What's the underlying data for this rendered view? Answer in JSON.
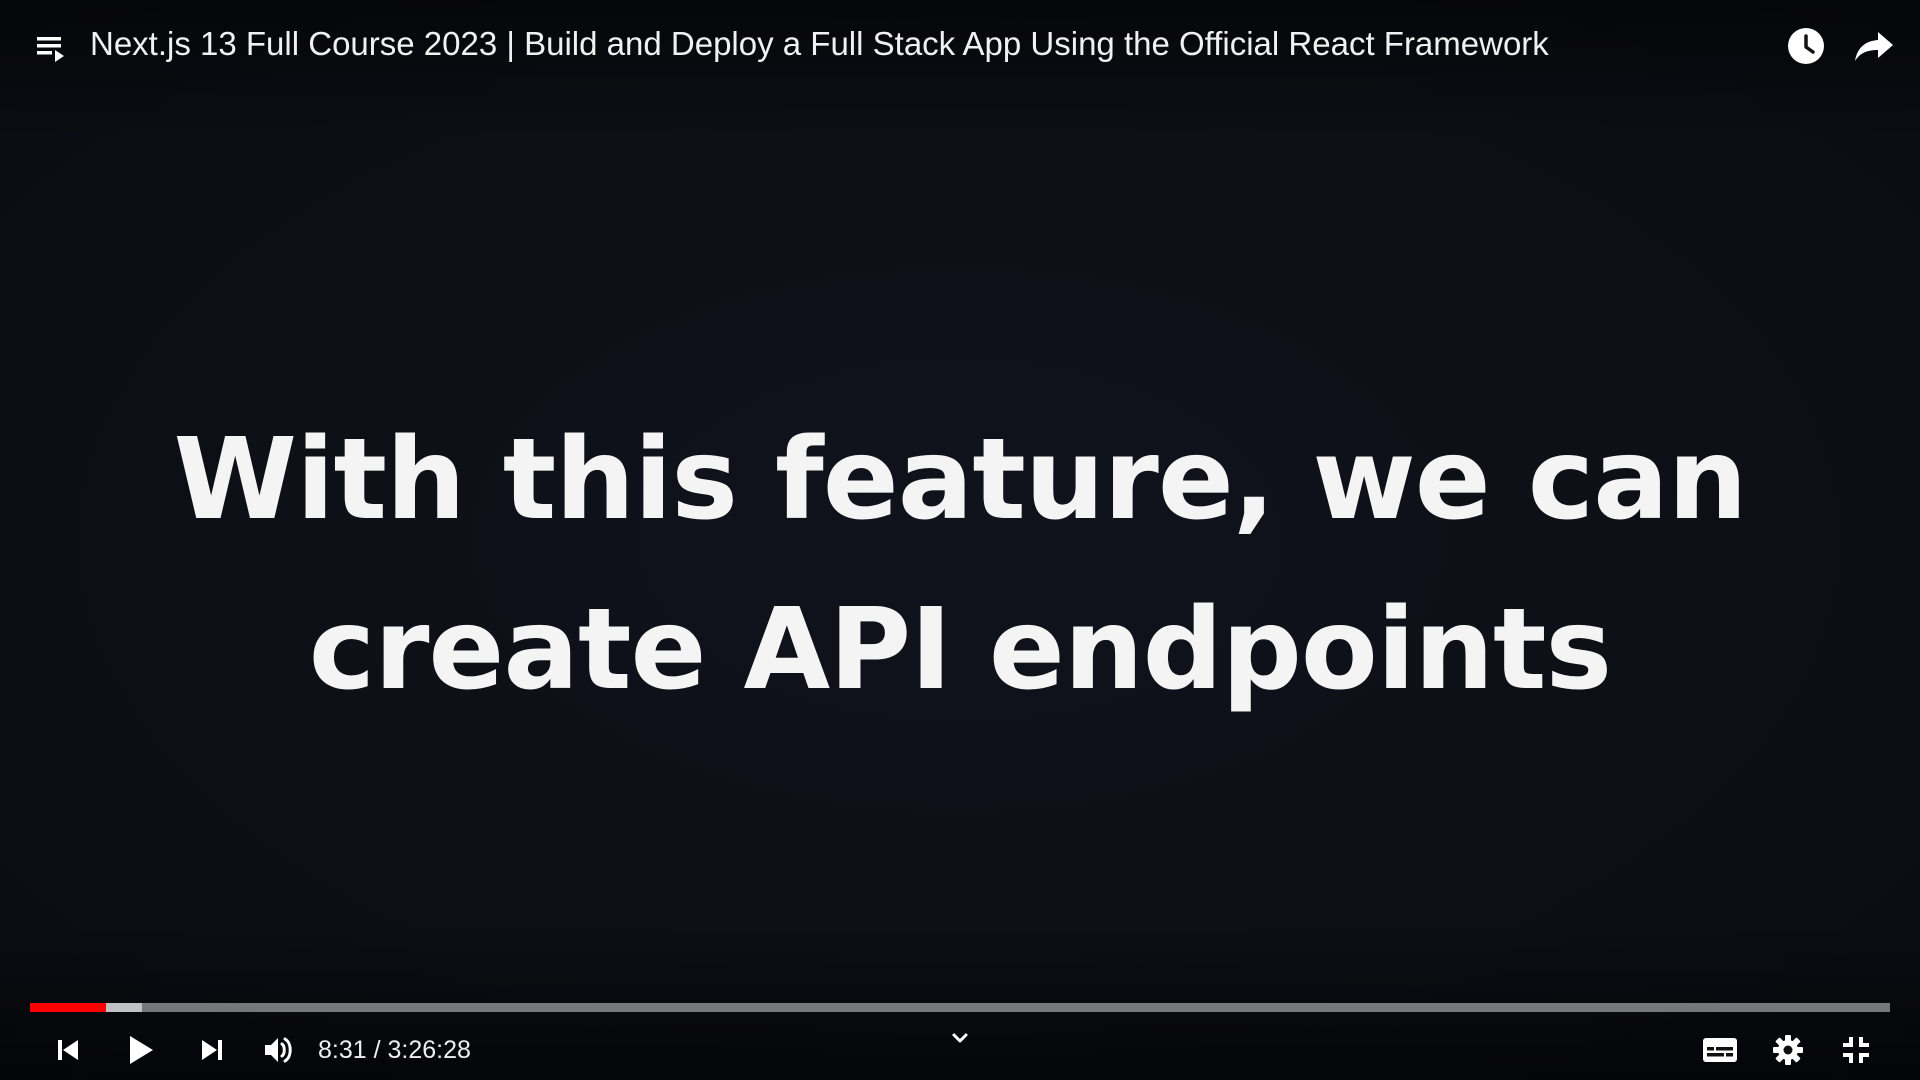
{
  "player": {
    "title": "Next.js 13 Full Course 2023 | Build and Deploy a Full Stack App Using the Official React Framework",
    "caption_lines": [
      "With this feature, we can",
      "create API endpoints"
    ],
    "time": {
      "current": "8:31",
      "separator": " / ",
      "duration": "3:26:28"
    },
    "progress": {
      "played_fraction": 0.041,
      "loaded_fraction": 0.06
    },
    "colors": {
      "progress_played": "#ff0000",
      "background": "#0d0f17"
    },
    "icons": {
      "playlist": "playlist-icon",
      "watch_later": "clock-icon",
      "share": "share-icon",
      "previous": "previous-icon",
      "play": "play-icon",
      "next": "next-icon",
      "volume": "volume-icon",
      "chapters": "chevron-down-icon",
      "subtitles": "subtitles-icon",
      "settings": "gear-icon",
      "exit_fullscreen": "exit-fullscreen-icon"
    }
  }
}
